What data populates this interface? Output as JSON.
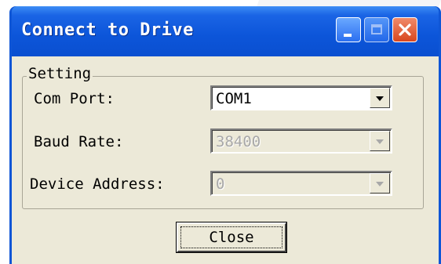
{
  "window": {
    "title": "Connect to Drive",
    "controls": [
      "minimize-icon",
      "maximize-icon",
      "close-icon"
    ]
  },
  "group": {
    "legend": "Setting",
    "fields": [
      {
        "label": "Com Port:",
        "value": "COM1",
        "enabled": true
      },
      {
        "label": "Baud Rate:",
        "value": "38400",
        "enabled": false
      },
      {
        "label": "Device Address:",
        "value": "0",
        "enabled": false
      }
    ]
  },
  "buttons": {
    "close_label": "Close"
  },
  "colors": {
    "titlebar": "#0c55d9",
    "client_bg": "#ece9d8",
    "close_button": "#d8471f"
  }
}
